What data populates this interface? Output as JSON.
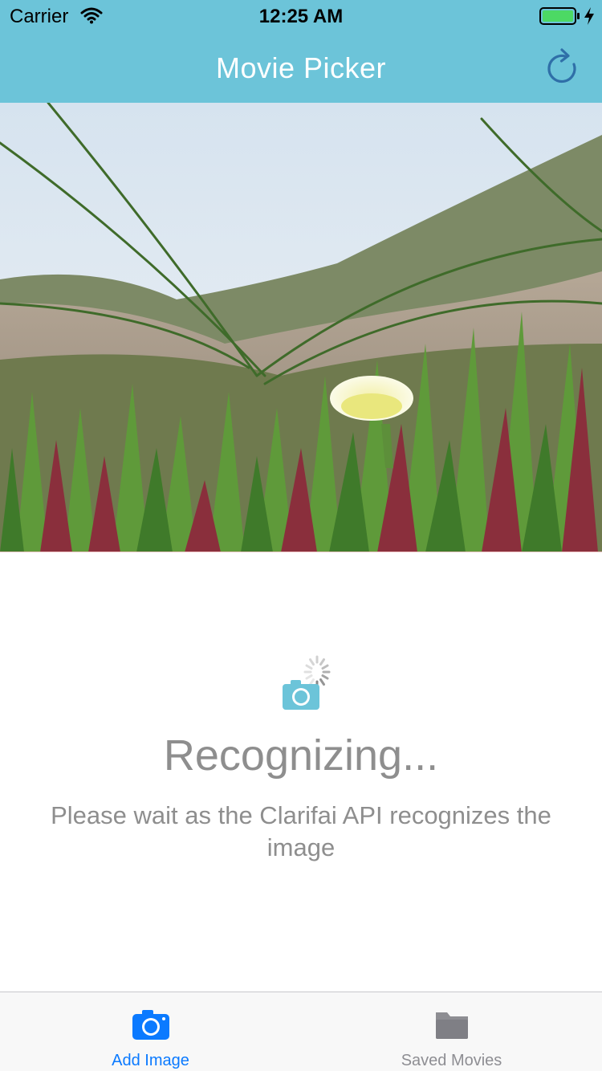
{
  "status_bar": {
    "carrier": "Carrier",
    "time": "12:25 AM",
    "battery_color": "#4cd964"
  },
  "nav_bar": {
    "title": "Movie Picker",
    "background_color": "#6cc4d9",
    "refresh_icon": "refresh-icon"
  },
  "image_view": {
    "alt": "Photo of a yellow ice plant flower among succulents on a sand dune"
  },
  "recognition": {
    "icon": "camera-icon",
    "title": "Recognizing...",
    "message": "Please wait as the Clarifai API recognizes the image"
  },
  "tab_bar": {
    "tabs": [
      {
        "label": "Add Image",
        "icon": "camera-icon",
        "active": true
      },
      {
        "label": "Saved Movies",
        "icon": "folder-icon",
        "active": false
      }
    ],
    "active_color": "#0b7aff",
    "inactive_color": "#8e8e93"
  }
}
